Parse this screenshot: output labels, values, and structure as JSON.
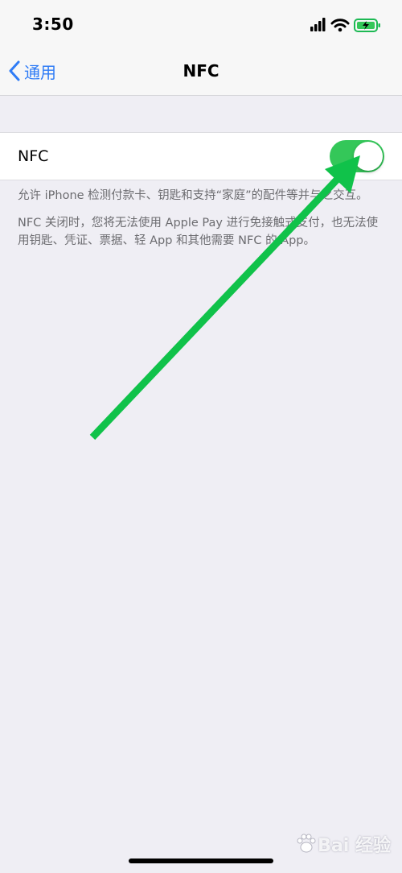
{
  "status_bar": {
    "time": "3:50"
  },
  "nav": {
    "back_label": "通用",
    "title": "NFC"
  },
  "settings": {
    "nfc_label": "NFC",
    "nfc_enabled": true
  },
  "footer": {
    "paragraph1": "允许 iPhone 检测付款卡、钥匙和支持“家庭”的配件等并与之交互。",
    "paragraph2": "NFC 关闭时，您将无法使用 Apple Pay 进行免接触式支付，也无法使用钥匙、凭证、票据、轻 App 和其他需要 NFC 的 App。"
  },
  "colors": {
    "accent": "#2f7cf6",
    "toggle_on": "#34c759",
    "arrow": "#10c24a",
    "background": "#efeef4"
  },
  "icons": [
    "signal-icon",
    "wifi-icon",
    "battery-charging-icon",
    "chevron-left-icon",
    "baidu-paw-icon"
  ],
  "watermark": {
    "text": "Bai 经验"
  }
}
